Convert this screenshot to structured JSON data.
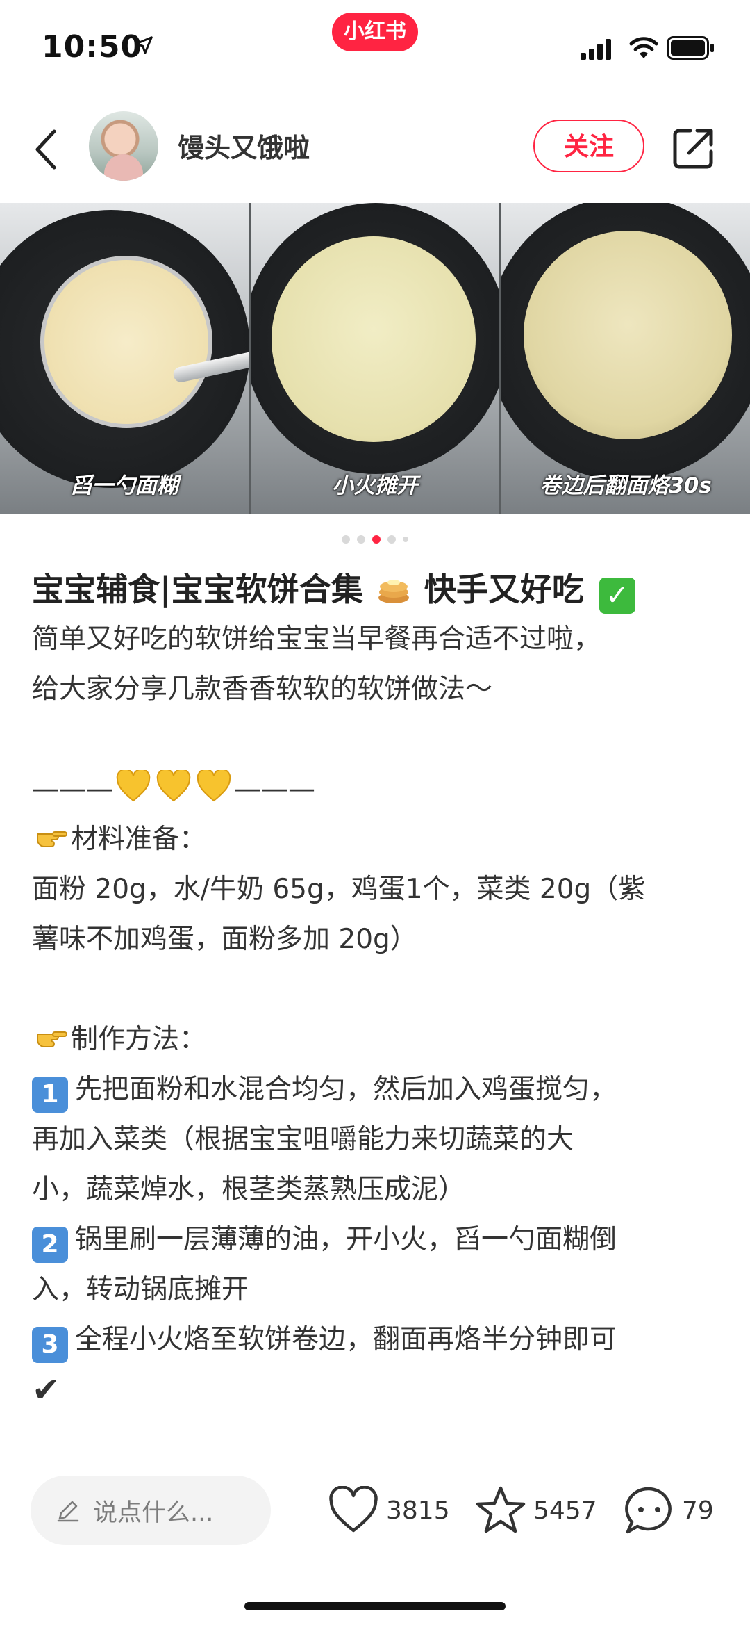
{
  "status_bar": {
    "time": "10:50",
    "brand": "小红书",
    "brand_color": "#ff2442"
  },
  "header": {
    "author_name": "馒头又饿啦",
    "follow_label": "关注",
    "back_icon": "chevron-left-icon",
    "share_icon": "share-icon"
  },
  "carousel": {
    "captions": [
      "舀一勺面糊",
      "小火摊开",
      "卷边后翻面烙30s"
    ],
    "page_count": 5,
    "active_page": 3
  },
  "note": {
    "title": "宝宝辅食|宝宝软饼合集",
    "title_suffix": "快手又好吃",
    "intro_1": "简单又好吃的软饼给宝宝当早餐再合适不过啦，",
    "intro_2": "给大家分享几款香香软软的软饼做法～",
    "divider_left": "———",
    "divider_right": "———",
    "materials_heading": "材料准备：",
    "materials_1": "面粉 20g，水/牛奶 65g，鸡蛋1个，菜类 20g（紫",
    "materials_2": "薯味不加鸡蛋，面粉多加 20g）",
    "method_heading": "制作方法：",
    "step1_num": "1",
    "step1_a": "先把面粉和水混合均匀，然后加入鸡蛋搅匀，",
    "step1_b": "再加入菜类（根据宝宝咀嚼能力来切蔬菜的大",
    "step1_c": "小，蔬菜焯水，根茎类蒸熟压成泥）",
    "step2_num": "2",
    "step2_a": "锅里刷一层薄薄的油，开小火，舀一勺面糊倒",
    "step2_b": "入，转动锅底摊开",
    "step3_num": "3",
    "step3_a": "全程小火烙至软饼卷边，翻面再烙半分钟即可",
    "step3_b": "✔"
  },
  "bottom_bar": {
    "comment_placeholder": "说点什么...",
    "likes": "3815",
    "collects": "5457",
    "comments": "79"
  }
}
